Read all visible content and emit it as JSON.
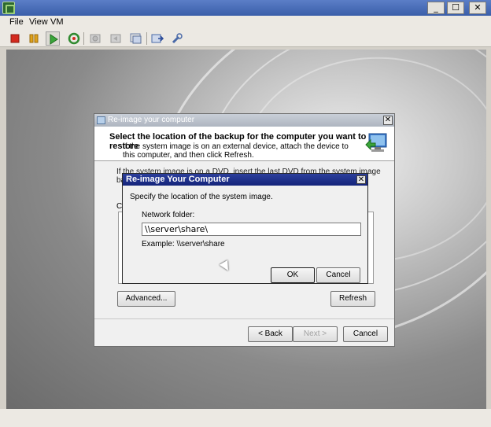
{
  "window": {
    "menu": [
      "File",
      "View",
      "VM"
    ],
    "controls": {
      "minimize": "_",
      "maximize": "☐",
      "close": "✕"
    }
  },
  "toolbar": {
    "icons": [
      "stop-icon",
      "pause-icon",
      "play-icon",
      "reset-icon",
      "snapshot-icon",
      "revert-icon",
      "manage-snapshots-icon",
      "send-keys-icon",
      "settings-icon"
    ],
    "colors": {
      "stop": "#d42a1e",
      "pause": "#e0a21a",
      "play": "#3aa53a",
      "reset": "#2f8a2f"
    }
  },
  "wizard": {
    "title": "Re-image your computer",
    "heading": "Select the location of the backup for the computer you want to restore",
    "subtext": "If the system image is on an external device, attach the device to this computer, and then click Refresh.",
    "body_text": "If the system image is on a DVD, insert the last DVD from the system image backup. Click Ad show up",
    "list_label": "Cu",
    "advanced_label": "Advanced...",
    "refresh_label": "Refresh",
    "back_label": "< Back",
    "next_label": "Next >",
    "cancel_label": "Cancel"
  },
  "modal": {
    "title": "Re-image Your Computer",
    "description": "Specify the location of the system image.",
    "field_label": "Network folder:",
    "field_value": "\\\\server\\share\\",
    "example": "Example: \\\\server\\share",
    "ok_label": "OK",
    "cancel_label": "Cancel"
  }
}
